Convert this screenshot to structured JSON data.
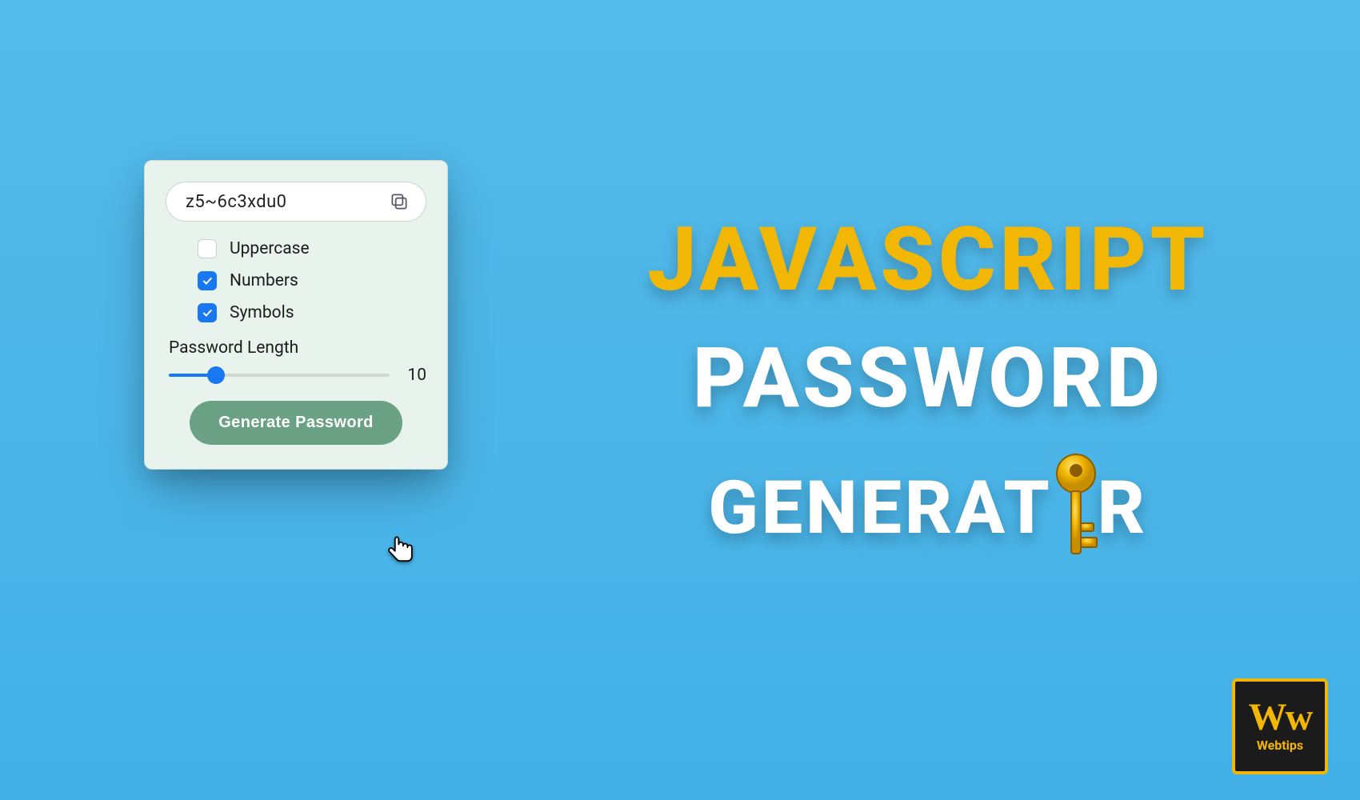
{
  "card": {
    "password_value": "z5~6c3xdu0",
    "options": [
      {
        "key": "uppercase",
        "label": "Uppercase",
        "checked": false
      },
      {
        "key": "numbers",
        "label": "Numbers",
        "checked": true
      },
      {
        "key": "symbols",
        "label": "Symbols",
        "checked": true
      }
    ],
    "length_label": "Password Length",
    "length_value": "10",
    "length_min": 4,
    "length_max": 32,
    "length_current": 10,
    "generate_label": "Generate Password"
  },
  "hero": {
    "line1": "JAVASCRIPT",
    "line2": "PASSWORD",
    "line3_pre": "GENERAT",
    "line3_post": "R"
  },
  "badge": {
    "logo": "Ww",
    "label": "Webtips"
  },
  "colors": {
    "accent_yellow": "#F2B705",
    "checkbox_blue": "#1877F2",
    "button_green": "#6BA185",
    "card_bg": "#E8F3EE"
  }
}
